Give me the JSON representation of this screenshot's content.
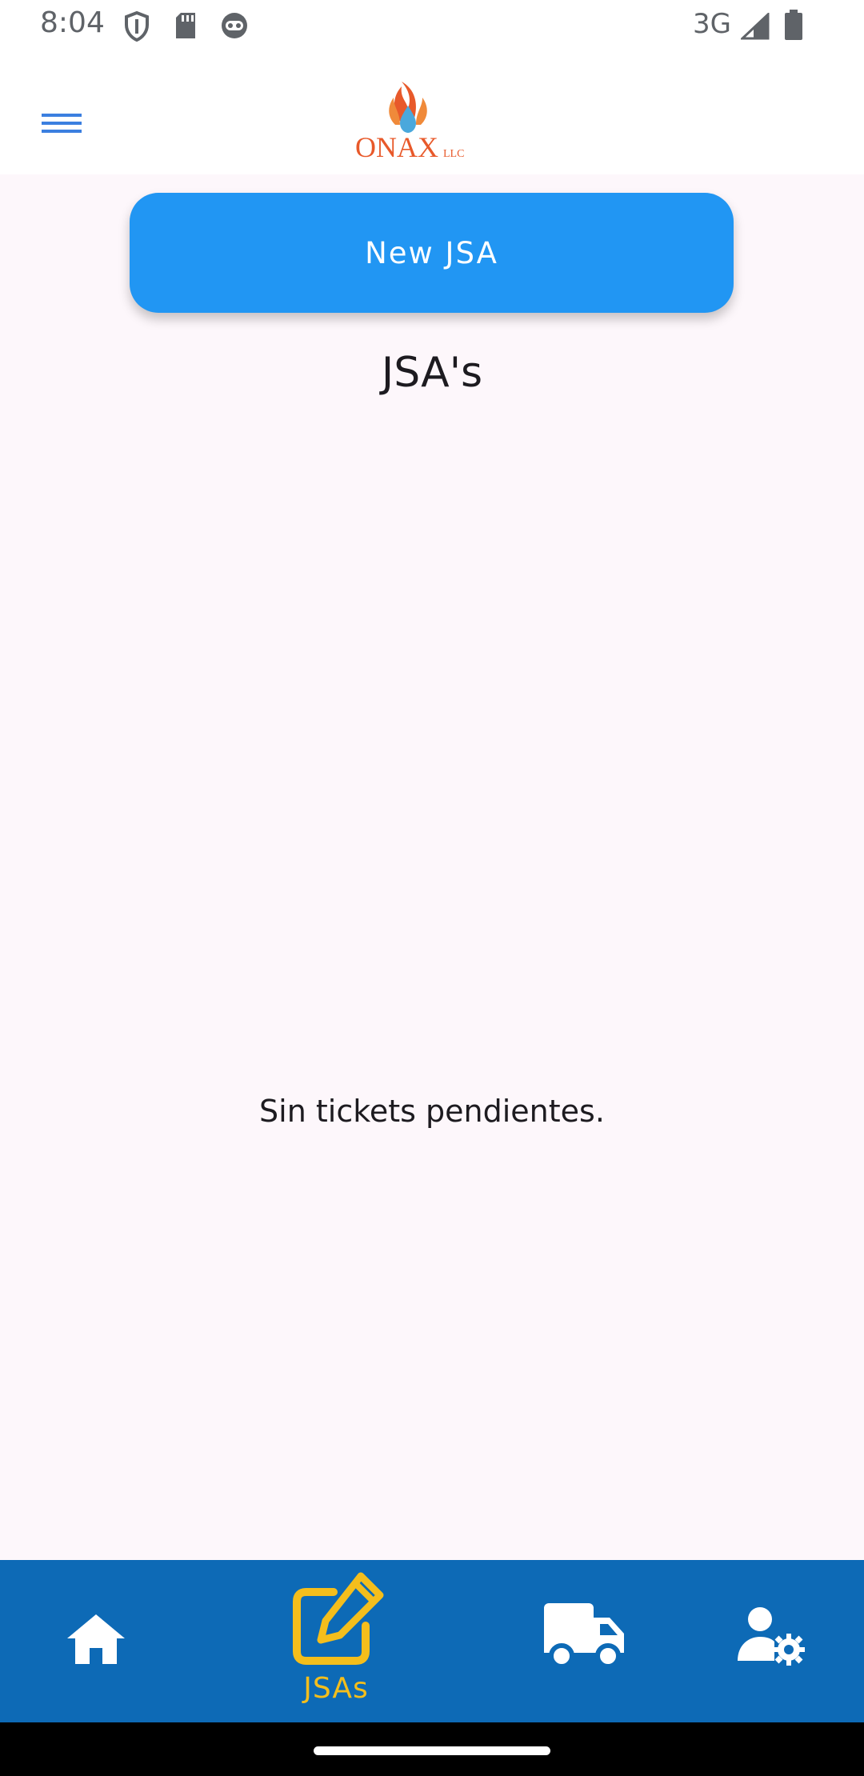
{
  "status_bar": {
    "time": "8:04",
    "network": "3G",
    "icons": [
      "shield-icon",
      "sd-card-icon",
      "android-icon",
      "signal-icon",
      "battery-icon"
    ]
  },
  "app_bar": {
    "menu_icon": "menu-icon",
    "logo_text": "ONAX",
    "logo_suffix": "LLC"
  },
  "main": {
    "new_button_label": "New JSA",
    "title": "JSA's",
    "empty_message": "Sin tickets pendientes."
  },
  "bottom_nav": {
    "items": [
      {
        "icon": "home-icon",
        "label": ""
      },
      {
        "icon": "edit-icon",
        "label": "JSAs",
        "active": true
      },
      {
        "icon": "truck-icon",
        "label": ""
      },
      {
        "icon": "user-settings-icon",
        "label": ""
      }
    ]
  },
  "colors": {
    "primary_button": "#2196f3",
    "nav_background": "#0d6ab6",
    "nav_active": "#f4be1c",
    "logo_orange": "#e8592a",
    "logo_drop": "#4aa8dc",
    "menu_blue": "#3b7fe0"
  }
}
